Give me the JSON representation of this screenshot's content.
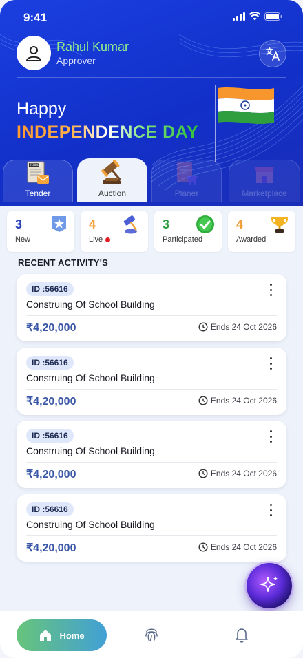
{
  "status_bar": {
    "time": "9:41"
  },
  "user": {
    "name": "Rahul Kumar",
    "role": "Approver"
  },
  "banner": {
    "line1": "Happy",
    "line2": "INDEPENDENCE DAY"
  },
  "tabs": [
    {
      "label": "Tender",
      "state": "inactive",
      "icon": "tender-document-icon"
    },
    {
      "label": "Auction",
      "state": "active",
      "icon": "gavel-icon"
    },
    {
      "label": "Planer",
      "state": "disabled",
      "icon": "planner-cart-icon"
    },
    {
      "label": "Marketplace",
      "state": "disabled",
      "icon": "marketplace-shop-icon"
    }
  ],
  "stats": [
    {
      "value": "3",
      "label": "New",
      "color": "#2a44b8",
      "icon": "star-badge-icon"
    },
    {
      "value": "4",
      "label": "Live",
      "color": "#f3a13a",
      "icon": "gavel-icon",
      "live_dot": true
    },
    {
      "value": "3",
      "label": "Participated",
      "color": "#2f9e3f",
      "icon": "check-circle-icon"
    },
    {
      "value": "4",
      "label": "Awarded",
      "color": "#f3a13a",
      "icon": "trophy-icon"
    }
  ],
  "section_title": "RECENT ACTIVITY'S",
  "activities": [
    {
      "id": "ID :56616",
      "title": "Construing Of School Building",
      "price": "₹4,20,000",
      "ends": "Ends 24 Oct 2026"
    },
    {
      "id": "ID :56616",
      "title": "Construing Of School Building",
      "price": "₹4,20,000",
      "ends": "Ends 24 Oct 2026"
    },
    {
      "id": "ID :56616",
      "title": "Construing Of School Building",
      "price": "₹4,20,000",
      "ends": "Ends 24 Oct 2026"
    },
    {
      "id": "ID :56616",
      "title": "Construing Of School Building",
      "price": "₹4,20,000",
      "ends": "Ends 24 Oct 2026"
    }
  ],
  "bottom_nav": {
    "home_label": "Home"
  },
  "colors": {
    "header_blue": "#1230c9",
    "accent_green": "#8ef08a",
    "price_blue": "#3a57a8"
  }
}
